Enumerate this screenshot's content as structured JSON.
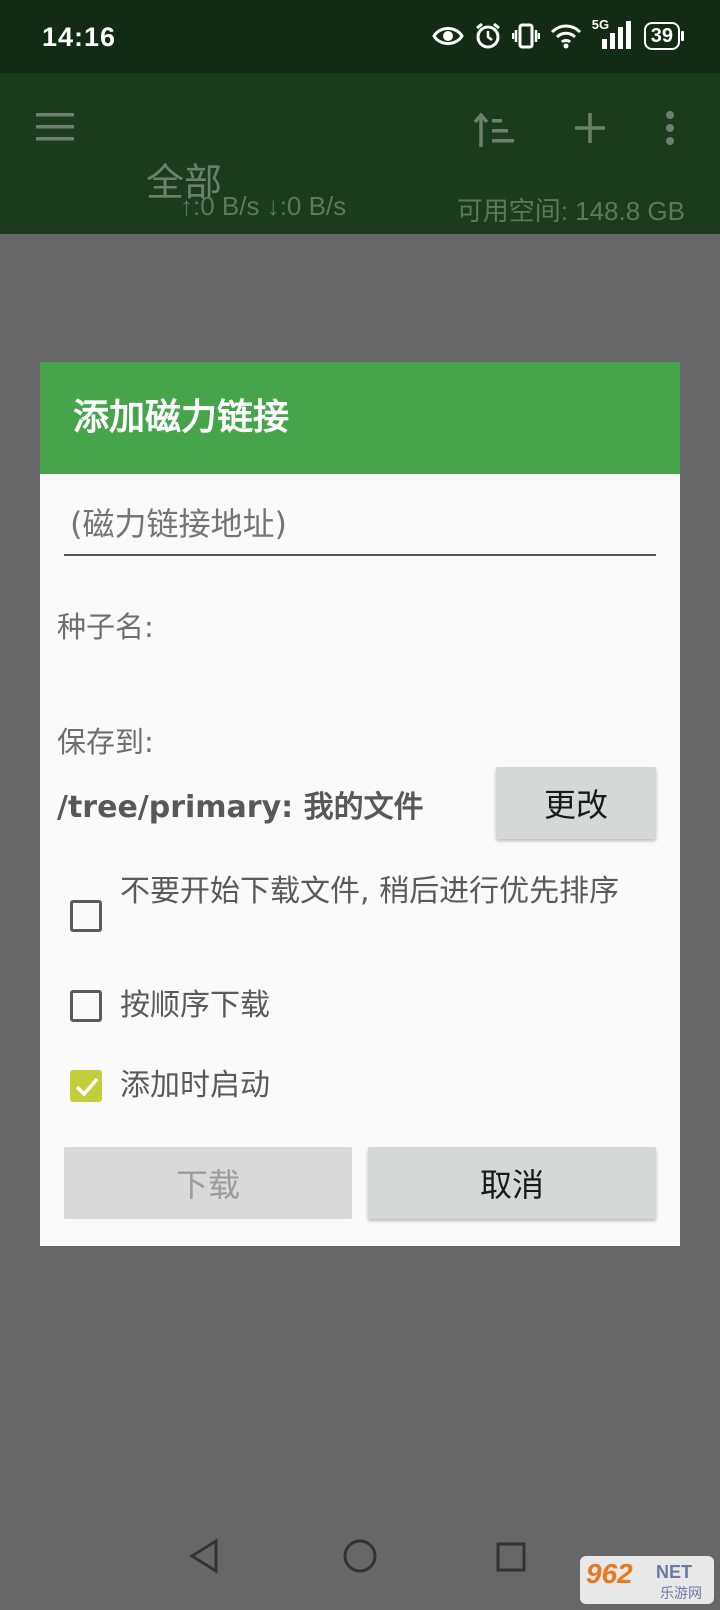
{
  "status_bar": {
    "time": "14:16",
    "battery": "39",
    "network": "5G",
    "icons": [
      "eye-icon",
      "alarm-icon",
      "vibrate-icon",
      "wifi-icon",
      "signal-icon",
      "battery-icon"
    ]
  },
  "app_bar": {
    "title": "全部",
    "speed": "↑:0 B/s ↓:0 B/s",
    "free_space": "可用空间: 148.8 GB",
    "icons": [
      "menu-icon",
      "sort-icon",
      "add-icon",
      "more-icon"
    ]
  },
  "dialog": {
    "title": "添加磁力链接",
    "magnet_placeholder": "(磁力链接地址)",
    "torrent_name_label": "种子名:",
    "save_to_label": "保存到:",
    "save_path": "/tree/primary: 我的文件",
    "change_button": "更改",
    "options": [
      {
        "label": "不要开始下载文件, 稍后进行优先排序",
        "checked": false
      },
      {
        "label": "按顺序下载",
        "checked": false
      },
      {
        "label": "添加时启动",
        "checked": true
      }
    ],
    "download_button": "下载",
    "cancel_button": "取消"
  },
  "nav_bar": {
    "icons": [
      "back-icon",
      "home-icon",
      "recents-icon"
    ]
  },
  "watermark": {
    "main": "962",
    "net": "NET",
    "sub": "乐游网"
  },
  "colors": {
    "status_bar": "#132a14",
    "app_bar": "#1b3b1c",
    "dialog_header": "#46a54b",
    "checkbox_checked": "#c3ce3a",
    "scrim": "#676767"
  }
}
